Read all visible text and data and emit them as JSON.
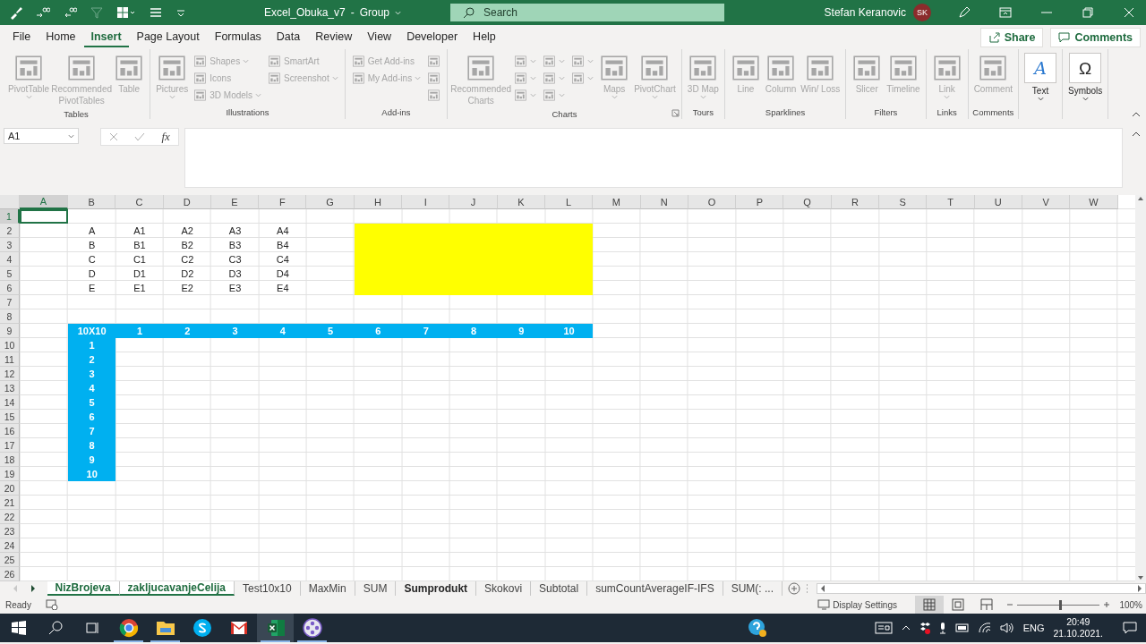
{
  "window": {
    "title": "Excel_Obuka_v7",
    "title_separator": "-",
    "title_suffix": "Group",
    "search_placeholder": "Search",
    "user": "Stefan Keranovic",
    "avatar": "SK"
  },
  "menu": {
    "tabs": [
      {
        "label": "File",
        "selected": false
      },
      {
        "label": "Home",
        "selected": false
      },
      {
        "label": "Insert",
        "selected": true
      },
      {
        "label": "Page Layout",
        "selected": false
      },
      {
        "label": "Formulas",
        "selected": false
      },
      {
        "label": "Data",
        "selected": false
      },
      {
        "label": "Review",
        "selected": false
      },
      {
        "label": "View",
        "selected": false
      },
      {
        "label": "Developer",
        "selected": false
      },
      {
        "label": "Help",
        "selected": false
      }
    ],
    "share": "Share",
    "comments": "Comments"
  },
  "ribbon": {
    "groups": [
      {
        "label": "Tables",
        "items": [
          {
            "kind": "large",
            "label": "PivotTable",
            "dropdown": true,
            "disabled": true
          },
          {
            "kind": "large",
            "label": "Recommended PivotTables",
            "dropdown": false,
            "disabled": true
          },
          {
            "kind": "large",
            "label": "Table",
            "dropdown": false,
            "disabled": true
          }
        ]
      },
      {
        "label": "Illustrations",
        "items": [
          {
            "kind": "large",
            "label": "Pictures",
            "dropdown": true,
            "disabled": true
          },
          {
            "kind": "stack",
            "items": [
              {
                "label": "Shapes",
                "dropdown": true,
                "disabled": true
              },
              {
                "label": "Icons",
                "dropdown": false,
                "disabled": true
              },
              {
                "label": "3D Models",
                "dropdown": true,
                "disabled": true
              }
            ]
          },
          {
            "kind": "stack",
            "items": [
              {
                "label": "SmartArt",
                "dropdown": false,
                "disabled": true
              },
              {
                "label": "Screenshot",
                "dropdown": true,
                "disabled": true
              }
            ]
          }
        ]
      },
      {
        "label": "Add-ins",
        "items": [
          {
            "kind": "stack",
            "items": [
              {
                "label": "Get Add-ins",
                "dropdown": false,
                "disabled": true
              },
              {
                "label": "My Add-ins",
                "dropdown": true,
                "disabled": true
              }
            ]
          },
          {
            "kind": "stack",
            "items": [
              {
                "dropdown": false,
                "disabled": true
              },
              {
                "dropdown": false,
                "disabled": true
              },
              {
                "dropdown": false,
                "disabled": true
              }
            ]
          }
        ]
      },
      {
        "label": "Charts",
        "launcher": true,
        "items": [
          {
            "kind": "large",
            "label": "Recommended Charts",
            "dropdown": false,
            "disabled": true
          },
          {
            "kind": "stack",
            "items": [
              {
                "dropdown": true,
                "disabled": true
              },
              {
                "dropdown": true,
                "disabled": true
              },
              {
                "dropdown": true,
                "disabled": true
              }
            ]
          },
          {
            "kind": "stack",
            "items": [
              {
                "dropdown": true,
                "disabled": true
              },
              {
                "dropdown": true,
                "disabled": true
              },
              {
                "dropdown": true,
                "disabled": true
              }
            ]
          },
          {
            "kind": "stack",
            "items": [
              {
                "dropdown": true,
                "disabled": true
              },
              {
                "dropdown": true,
                "disabled": true
              }
            ]
          },
          {
            "kind": "large",
            "label": "Maps",
            "dropdown": true,
            "disabled": true
          },
          {
            "kind": "large",
            "label": "PivotChart",
            "dropdown": true,
            "disabled": true
          }
        ]
      },
      {
        "label": "Tours",
        "items": [
          {
            "kind": "large",
            "label": "3D Map",
            "dropdown": true,
            "disabled": true
          }
        ]
      },
      {
        "label": "Sparklines",
        "items": [
          {
            "kind": "large",
            "label": "Line",
            "dropdown": false,
            "disabled": true
          },
          {
            "kind": "large",
            "label": "Column",
            "dropdown": false,
            "disabled": true
          },
          {
            "kind": "large",
            "label": "Win/ Loss",
            "dropdown": false,
            "disabled": true
          }
        ]
      },
      {
        "label": "Filters",
        "items": [
          {
            "kind": "large",
            "label": "Slicer",
            "dropdown": false,
            "disabled": true
          },
          {
            "kind": "large",
            "label": "Timeline",
            "dropdown": false,
            "disabled": true
          }
        ]
      },
      {
        "label": "Links",
        "items": [
          {
            "kind": "large",
            "label": "Link",
            "dropdown": true,
            "disabled": true
          }
        ]
      },
      {
        "label": "Comments",
        "items": [
          {
            "kind": "large",
            "label": "Comment",
            "dropdown": false,
            "disabled": true
          }
        ]
      },
      {
        "items": [
          {
            "kind": "glyph",
            "glyph": "A",
            "label": "Text",
            "dropdown": true,
            "disabled": false
          }
        ]
      },
      {
        "items": [
          {
            "kind": "glyph",
            "glyph": "Ω",
            "label": "Symbols",
            "dropdown": true,
            "disabled": false
          }
        ]
      }
    ]
  },
  "formula_bar": {
    "name_box": "A1",
    "function_label": "fx"
  },
  "sheet": {
    "columns": [
      {
        "label": "A",
        "selected": true
      },
      {
        "label": "B",
        "selected": false
      },
      {
        "label": "C",
        "selected": false
      },
      {
        "label": "D",
        "selected": false
      },
      {
        "label": "E",
        "selected": false
      },
      {
        "label": "F",
        "selected": false
      },
      {
        "label": "G",
        "selected": false
      },
      {
        "label": "H",
        "selected": false
      },
      {
        "label": "I",
        "selected": false
      },
      {
        "label": "J",
        "selected": false
      },
      {
        "label": "K",
        "selected": false
      },
      {
        "label": "L",
        "selected": false
      },
      {
        "label": "M",
        "selected": false
      },
      {
        "label": "N",
        "selected": false
      },
      {
        "label": "O",
        "selected": false
      },
      {
        "label": "P",
        "selected": false
      },
      {
        "label": "Q",
        "selected": false
      },
      {
        "label": "R",
        "selected": false
      },
      {
        "label": "S",
        "selected": false
      },
      {
        "label": "T",
        "selected": false
      },
      {
        "label": "U",
        "selected": false
      },
      {
        "label": "V",
        "selected": false
      },
      {
        "label": "W",
        "selected": false
      }
    ],
    "rows": [
      {
        "header": "1",
        "selected": true,
        "kind": "plain"
      },
      {
        "header": "2",
        "selected": false,
        "kind": "plain",
        "cells": [
          "A",
          "A1",
          "A2",
          "A3",
          "A4"
        ]
      },
      {
        "header": "3",
        "selected": false,
        "kind": "plain",
        "cells": [
          "B",
          "B1",
          "B2",
          "B3",
          "B4"
        ]
      },
      {
        "header": "4",
        "selected": false,
        "kind": "plain",
        "cells": [
          "C",
          "C1",
          "C2",
          "C3",
          "C4"
        ]
      },
      {
        "header": "5",
        "selected": false,
        "kind": "plain",
        "cells": [
          "D",
          "D1",
          "D2",
          "D3",
          "D4"
        ]
      },
      {
        "header": "6",
        "selected": false,
        "kind": "plain",
        "cells": [
          "E",
          "E1",
          "E2",
          "E3",
          "E4"
        ]
      },
      {
        "header": "7",
        "selected": false,
        "kind": "plain"
      },
      {
        "header": "8",
        "selected": false,
        "kind": "plain"
      },
      {
        "header": "9",
        "selected": false,
        "kind": "header_row",
        "cells": [
          "10X10",
          "1",
          "2",
          "3",
          "4",
          "5",
          "6",
          "7",
          "8",
          "9",
          "10"
        ]
      },
      {
        "header": "10",
        "selected": false,
        "kind": "header_column",
        "cells": [
          "1"
        ]
      },
      {
        "header": "11",
        "selected": false,
        "kind": "header_column",
        "cells": [
          "2"
        ]
      },
      {
        "header": "12",
        "selected": false,
        "kind": "header_column",
        "cells": [
          "3"
        ]
      },
      {
        "header": "13",
        "selected": false,
        "kind": "header_column",
        "cells": [
          "4"
        ]
      },
      {
        "header": "14",
        "selected": false,
        "kind": "header_column",
        "cells": [
          "5"
        ]
      },
      {
        "header": "15",
        "selected": false,
        "kind": "header_column",
        "cells": [
          "6"
        ]
      },
      {
        "header": "16",
        "selected": false,
        "kind": "header_column",
        "cells": [
          "7"
        ]
      },
      {
        "header": "17",
        "selected": false,
        "kind": "header_column",
        "cells": [
          "8"
        ]
      },
      {
        "header": "18",
        "selected": false,
        "kind": "header_column",
        "cells": [
          "9"
        ]
      },
      {
        "header": "19",
        "selected": false,
        "kind": "header_column",
        "cells": [
          "10"
        ]
      },
      {
        "header": "20",
        "selected": false,
        "kind": "plain"
      },
      {
        "header": "21",
        "selected": false,
        "kind": "plain"
      },
      {
        "header": "22",
        "selected": false,
        "kind": "plain"
      },
      {
        "header": "23",
        "selected": false,
        "kind": "plain"
      },
      {
        "header": "24",
        "selected": false,
        "kind": "plain"
      },
      {
        "header": "25",
        "selected": false,
        "kind": "plain"
      },
      {
        "header": "26",
        "selected": false,
        "kind": "plain"
      }
    ]
  },
  "sheet_tabs": [
    {
      "label": "NizBrojeva",
      "selected": true,
      "bold": true
    },
    {
      "label": "zakljucavanjeCelija",
      "selected": true,
      "bold": true
    },
    {
      "label": "Test10x10",
      "selected": false,
      "bold": false
    },
    {
      "label": "MaxMin",
      "selected": false,
      "bold": false
    },
    {
      "label": "SUM",
      "selected": false,
      "bold": false
    },
    {
      "label": "Sumprodukt",
      "selected": false,
      "bold": true
    },
    {
      "label": "Skokovi",
      "selected": false,
      "bold": false
    },
    {
      "label": "Subtotal",
      "selected": false,
      "bold": false
    },
    {
      "label": "sumCountAverageIF-IFS",
      "selected": false,
      "bold": false
    },
    {
      "label": "SUM(: ...",
      "selected": false,
      "bold": false
    }
  ],
  "status_bar": {
    "status": "Ready",
    "display_settings": "Display Settings",
    "views": [
      {
        "kind": "normal",
        "selected": true
      },
      {
        "kind": "page_layout",
        "selected": false
      },
      {
        "kind": "page_break",
        "selected": false
      }
    ],
    "zoom": {
      "level": 0.52,
      "reading": "100%"
    }
  },
  "taskbar": {
    "apps": [
      {
        "kind": "browser",
        "running": true,
        "selected": false
      },
      {
        "kind": "folder",
        "running": true,
        "selected": false
      },
      {
        "kind": "chat",
        "running": false,
        "selected": false
      },
      {
        "kind": "mail",
        "running": false,
        "selected": false
      },
      {
        "kind": "spreadsheet",
        "running": true,
        "selected": true
      },
      {
        "kind": "video",
        "running": true,
        "selected": false
      }
    ],
    "language": "ENG",
    "time": "20:49",
    "date": "21.10.2021."
  }
}
